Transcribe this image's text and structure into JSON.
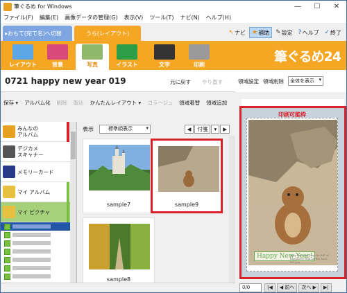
{
  "window": {
    "title": "筆ぐるめ for Windows",
    "min": "—",
    "max": "☐",
    "close": "✕"
  },
  "menu": [
    "ファイル(F)",
    "編集(E)",
    "画像データの管理(G)",
    "表示(V)",
    "ツール(T)",
    "ナビ(N)",
    "ヘルプ(H)"
  ],
  "tabs": {
    "front": "▸おもて(宛て名)へ切替",
    "back": "うら(レイアウト)"
  },
  "toolbar": [
    {
      "label": "ナビ",
      "icon": "pointer-icon",
      "glyph": "↖",
      "color": "#e8901a",
      "active": false
    },
    {
      "label": "補助",
      "icon": "star-icon",
      "glyph": "★",
      "color": "#e8901a",
      "active": true
    },
    {
      "label": "設定",
      "icon": "wrench-icon",
      "glyph": "✎",
      "color": "#444444",
      "active": false
    },
    {
      "label": "ヘルプ",
      "icon": "question-icon",
      "glyph": "?",
      "color": "#2a64c8",
      "active": false
    },
    {
      "label": "終了",
      "icon": "check-icon",
      "glyph": "✓",
      "color": "#2a64c8",
      "active": false
    }
  ],
  "ribbon": [
    {
      "label": "レイアウト",
      "icon": "layout-icon",
      "color": "#5da7e6",
      "active": false
    },
    {
      "label": "背景",
      "icon": "background-icon",
      "color": "#d84a7a",
      "active": false
    },
    {
      "label": "写真",
      "icon": "photo-icon",
      "color": "#8fb86a",
      "active": true
    },
    {
      "label": "イラスト",
      "icon": "illustration-icon",
      "color": "#2e9d47",
      "active": false
    },
    {
      "label": "文字",
      "icon": "text-icon",
      "color": "#333333",
      "active": false
    },
    {
      "label": "印刷",
      "icon": "printer-icon",
      "color": "#9a9a9a",
      "active": false
    }
  ],
  "logo": "筆ぐるめ24",
  "doc": {
    "title": "0721 happy new year 019",
    "undo": "元に戻す",
    "redo": "やり直す"
  },
  "tools": [
    {
      "label": "保存 ▾",
      "disabled": false
    },
    {
      "label": "アルバム化",
      "disabled": false
    },
    {
      "label": "削除",
      "disabled": true
    },
    {
      "label": "取込",
      "disabled": true
    },
    {
      "label": "かんたんレイアウト ▾",
      "disabled": false
    },
    {
      "label": "コラージュ",
      "disabled": true
    },
    {
      "label": "領域着替",
      "disabled": false
    },
    {
      "label": "領域追加",
      "disabled": false
    }
  ],
  "right_tools": {
    "set": "領域設定",
    "delete": "領域削除",
    "view": "全体を表示"
  },
  "categories": [
    {
      "label": "みんなの\nアルバム",
      "icon": "shared-album-icon",
      "color": "#e8a020",
      "tab": "#d92128",
      "selected": false
    },
    {
      "label": "デジカメ\nスキャナー",
      "icon": "camera-icon",
      "color": "#555555",
      "tab": "",
      "selected": false
    },
    {
      "label": "メモリーカード",
      "icon": "memory-card-icon",
      "color": "#2a3a8a",
      "tab": "",
      "selected": false
    },
    {
      "label": "マイ アルバム",
      "icon": "my-album-icon",
      "color": "#e8c040",
      "tab": "#7ac043",
      "selected": false
    },
    {
      "label": "マイ ピクチャ",
      "icon": "my-pictures-icon",
      "color": "#e8c040",
      "tab": "#7ac043",
      "selected": true
    }
  ],
  "subfolder_count": 7,
  "view": {
    "label": "表示",
    "mode": "標準順表示",
    "sort": "付箋"
  },
  "thumbnails": [
    {
      "caption": "sample7",
      "selected": false,
      "scene": "castle"
    },
    {
      "caption": "sample9",
      "selected": true,
      "scene": "squirrel"
    },
    {
      "caption": "sample8",
      "selected": false,
      "scene": "forest"
    }
  ],
  "preview": {
    "print_area": "印刷可能枠",
    "greeting": "Happy New Year!",
    "message": "May the new year be full of happiness and all the best for you"
  },
  "nav": {
    "page": "0/0",
    "first": "|◀",
    "prev": "◀ 前へ",
    "next": "次へ ▶",
    "last": "▶|"
  }
}
